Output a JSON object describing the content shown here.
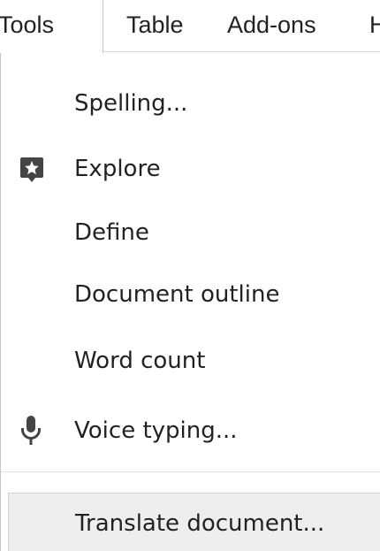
{
  "menubar": {
    "items": [
      {
        "label": "Tools"
      },
      {
        "label": "Table"
      },
      {
        "label": "Add-ons"
      },
      {
        "label": "H"
      }
    ]
  },
  "tools_menu": {
    "items": [
      {
        "label": "Spelling...",
        "icon": ""
      },
      {
        "label": "Explore",
        "icon": "explore-icon"
      },
      {
        "label": "Define",
        "icon": ""
      },
      {
        "label": "Document outline",
        "icon": ""
      },
      {
        "label": "Word count",
        "icon": ""
      },
      {
        "label": "Voice typing...",
        "icon": "microphone-icon"
      }
    ],
    "after_separator": [
      {
        "label": "Translate document...",
        "state": "hovered"
      }
    ]
  },
  "colors": {
    "text": "#222222",
    "icon": "#444444",
    "hover_bg": "#eeeeee",
    "separator": "#e0e0e0"
  }
}
